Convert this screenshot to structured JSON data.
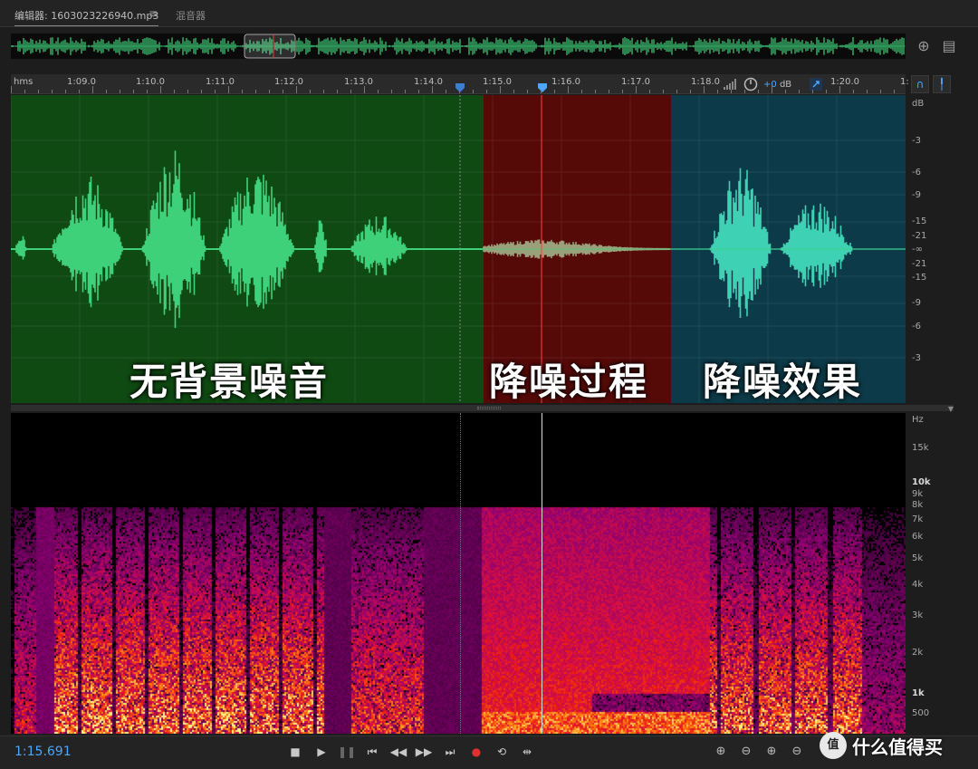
{
  "tabs": {
    "editor_label": "编辑器: 1603023226940.mp3",
    "menu_icon": "≡",
    "mixer_label": "混音器"
  },
  "ruler": {
    "unit": "hms",
    "ticks": [
      "1:09.0",
      "1:10.0",
      "1:11.0",
      "1:12.0",
      "1:13.0",
      "1:14.0",
      "1:15.0",
      "1:16.0",
      "1:17.0",
      "1:18.0",
      "1:20.0",
      "1:"
    ],
    "gain_value": "+0",
    "gain_unit": "dB"
  },
  "regions": [
    {
      "label": "无背景噪音",
      "color": "#0f4a12"
    },
    {
      "label": "降噪过程",
      "color": "#560a08"
    },
    {
      "label": "降噪效果",
      "color": "#0d3a48"
    }
  ],
  "db_axis": {
    "unit": "dB",
    "labels": [
      "-3",
      "-6",
      "-9",
      "-15",
      "-21",
      "-∞",
      "-21",
      "-15",
      "-9",
      "-6",
      "-3"
    ]
  },
  "hz_axis": {
    "unit": "Hz",
    "labels": [
      "15k",
      "10k",
      "9k",
      "8k",
      "7k",
      "6k",
      "5k",
      "4k",
      "3k",
      "2k",
      "1k",
      "500"
    ]
  },
  "transport": {
    "timecode": "1:15.691"
  },
  "watermark": {
    "badge": "值",
    "text": "什么值得买"
  },
  "colors": {
    "accent": "#4aa6ff",
    "wave_green": "#3fd17a",
    "wave_teal": "#3ed1b4",
    "wave_red_region": "#9aa07a"
  }
}
